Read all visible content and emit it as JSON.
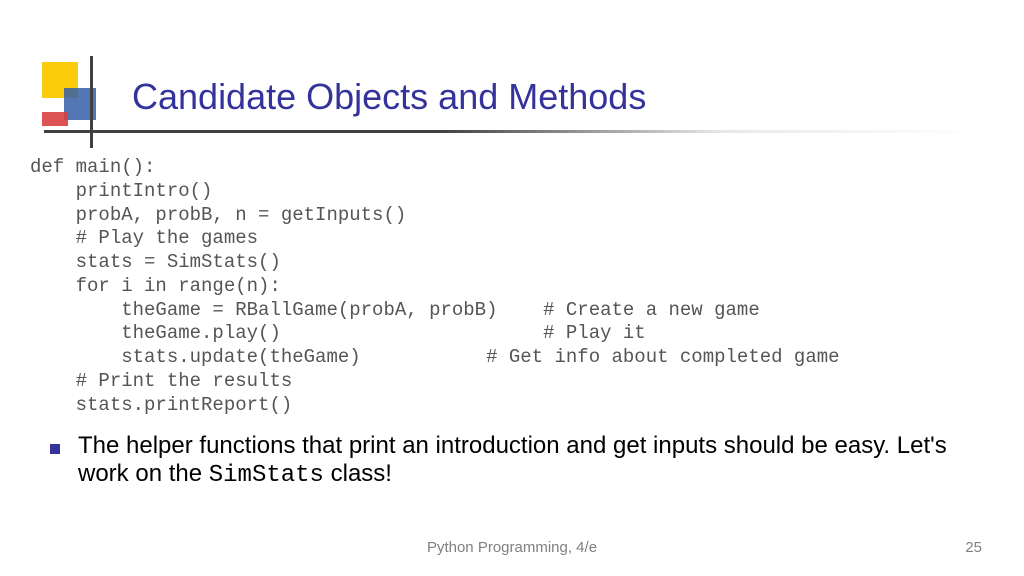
{
  "title": "Candidate Objects and Methods",
  "code": "def main():\n    printIntro()\n    probA, probB, n = getInputs()\n    # Play the games\n    stats = SimStats()\n    for i in range(n):\n        theGame = RBallGame(probA, probB)    # Create a new game\n        theGame.play()                       # Play it\n        stats.update(theGame)           # Get info about completed game\n    # Print the results\n    stats.printReport()",
  "bullet": {
    "pre": "The helper functions that print an introduction and get inputs should be easy. Let's work on the ",
    "mono": "SimStats",
    "post": " class!"
  },
  "footer": {
    "center": "Python Programming, 4/e",
    "page": "25"
  }
}
